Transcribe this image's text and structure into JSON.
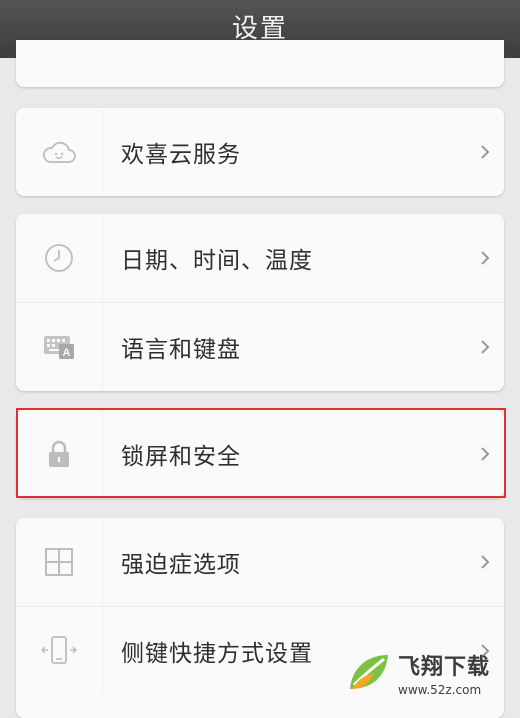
{
  "header": {
    "title": "设置"
  },
  "groups": [
    {
      "items": [
        {
          "label": "欢喜云服务",
          "icon": "cloud-icon"
        }
      ]
    },
    {
      "items": [
        {
          "label": "日期、时间、温度",
          "icon": "clock-icon"
        },
        {
          "label": "语言和键盘",
          "icon": "keyboard-icon"
        }
      ]
    },
    {
      "items": [
        {
          "label": "锁屏和安全",
          "icon": "lock-icon"
        }
      ]
    },
    {
      "items": [
        {
          "label": "强迫症选项",
          "icon": "grid-icon"
        },
        {
          "label": "侧键快捷方式设置",
          "icon": "side-key-phone-icon"
        }
      ]
    }
  ],
  "watermark": {
    "brand": "飞翔下载",
    "url": "www.52z.com"
  },
  "colors": {
    "highlight": "#e52b33",
    "header": "#474747",
    "background": "#e9e9ec"
  }
}
